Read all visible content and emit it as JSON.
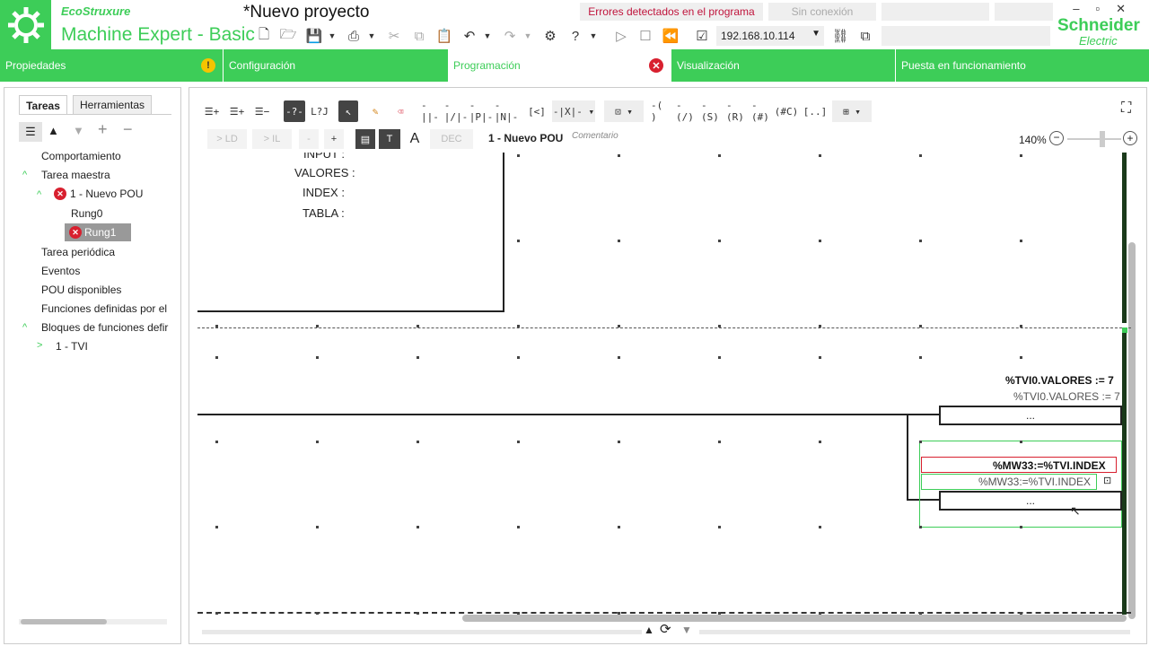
{
  "app": {
    "brand": "EcoStruxure",
    "name": "Machine Expert - Basic",
    "project_title": "*Nuevo proyecto",
    "error_status": "Errores detectados en el programa",
    "connection_status": "Sin conexión",
    "ip_address": "192.168.10.114",
    "vendor_top": "Schneider",
    "vendor_bottom": "Electric"
  },
  "nav": {
    "tabs": [
      {
        "label": "Propiedades",
        "badge": "warning"
      },
      {
        "label": "Configuración"
      },
      {
        "label": "Programación",
        "active": true,
        "badge": "error"
      },
      {
        "label": "Visualización"
      },
      {
        "label": "Puesta en funcionamiento"
      }
    ]
  },
  "left_panel": {
    "tabs": [
      "Tareas",
      "Herramientas"
    ],
    "tree": [
      {
        "label": "Comportamiento"
      },
      {
        "label": "Tarea maestra",
        "expanded": true
      },
      {
        "label": "1 - Nuevo POU",
        "expanded": true,
        "error": true
      },
      {
        "label": "Rung0"
      },
      {
        "label": "Rung1",
        "error": true,
        "selected": true
      },
      {
        "label": "Tarea periódica"
      },
      {
        "label": "Eventos"
      },
      {
        "label": "POU disponibles"
      },
      {
        "label": "Funciones definidas por el"
      },
      {
        "label": "Bloques de funciones defir",
        "expanded": true
      },
      {
        "label": "1 - TVI",
        "collapsed": true
      }
    ]
  },
  "editor": {
    "toolbar2": {
      "ld_label": "> LD",
      "il_label": "> IL",
      "minus_label": "-",
      "plus_label": "+",
      "dec_label": "DEC",
      "pou_title": "1 - Nuevo POU",
      "comment_label": "Comentario"
    },
    "zoom": "140%",
    "fb_inputs": [
      "INPUT :",
      "VALORES :",
      "INDEX :",
      "TABLA :"
    ],
    "op1": {
      "expression_bold": "%TVI0.VALORES := 7",
      "expression": "%TVI0.VALORES := 7",
      "box_text": "..."
    },
    "op2": {
      "expression_bold": "%MW33:=%TVI.INDEX",
      "expression": "%MW33:=%TVI.INDEX",
      "box_text": "..."
    }
  },
  "colors": {
    "accent": "#3dcd58",
    "error": "#d8202f",
    "warning": "#f5c400"
  }
}
